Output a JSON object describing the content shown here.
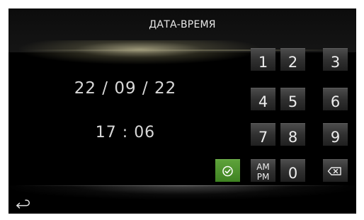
{
  "header": {
    "title": "ДАТА-ВРЕМЯ"
  },
  "display": {
    "date": "22 / 09 / 22",
    "time": "17 : 06"
  },
  "keypad": {
    "keys": [
      "1",
      "2",
      "3",
      "4",
      "5",
      "6",
      "7",
      "8",
      "9",
      "0"
    ],
    "ampm_top": "AM",
    "ampm_bottom": "PM",
    "confirm_icon": "check-circle-icon",
    "backspace_icon": "backspace-icon"
  },
  "footer": {
    "back_icon": "back-arrow-icon"
  },
  "colors": {
    "background": "#000000",
    "confirm": "#4a8f2a",
    "key": "#3a3a3a",
    "text": "#d8d8d8"
  }
}
